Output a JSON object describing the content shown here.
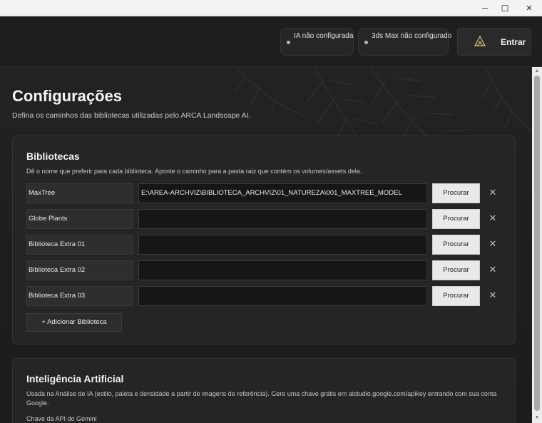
{
  "window": {
    "minimize_glyph": "─",
    "maximize_glyph": "☐",
    "close_glyph": "✕"
  },
  "header": {
    "status_ia": "IA não configurada",
    "status_max": "3ds Max não configurado",
    "login_label": "Entrar"
  },
  "page": {
    "title": "Configurações",
    "subtitle": "Defina os caminhos das bibliotecas utilizadas pelo ARCA Landscape AI."
  },
  "libraries": {
    "title": "Bibliotecas",
    "description": "Dê o nome que preferir para cada biblioteca. Aponte o caminho para a pasta raiz que contém os volumes/assets dela.",
    "browse_label": "Procurar",
    "remove_glyph": "✕",
    "add_label": "+ Adicionar Biblioteca",
    "rows": [
      {
        "name": "MaxTree",
        "path": "E:\\AREA-ARCHVIZ\\BIBLIOTECA_ARCHVIZ\\01_NATUREZA\\001_MAXTREE_MODEL"
      },
      {
        "name": "Globe Plants",
        "path": ""
      },
      {
        "name": "Biblioteca Extra 01",
        "path": ""
      },
      {
        "name": "Biblioteca Extra 02",
        "path": ""
      },
      {
        "name": "Biblioteca Extra 03",
        "path": ""
      }
    ]
  },
  "ai": {
    "title": "Inteligência Artificial",
    "description": "Usada na Análise de IA (estilo, paleta e densidade a partir de imagens de referência). Gere uma chave grátis em aistudio.google.com/apikey entrando com sua conta Google.",
    "api_key_label": "Chave da API do Gemini"
  },
  "scrollbar": {
    "up_glyph": "▲",
    "down_glyph": "▼"
  }
}
